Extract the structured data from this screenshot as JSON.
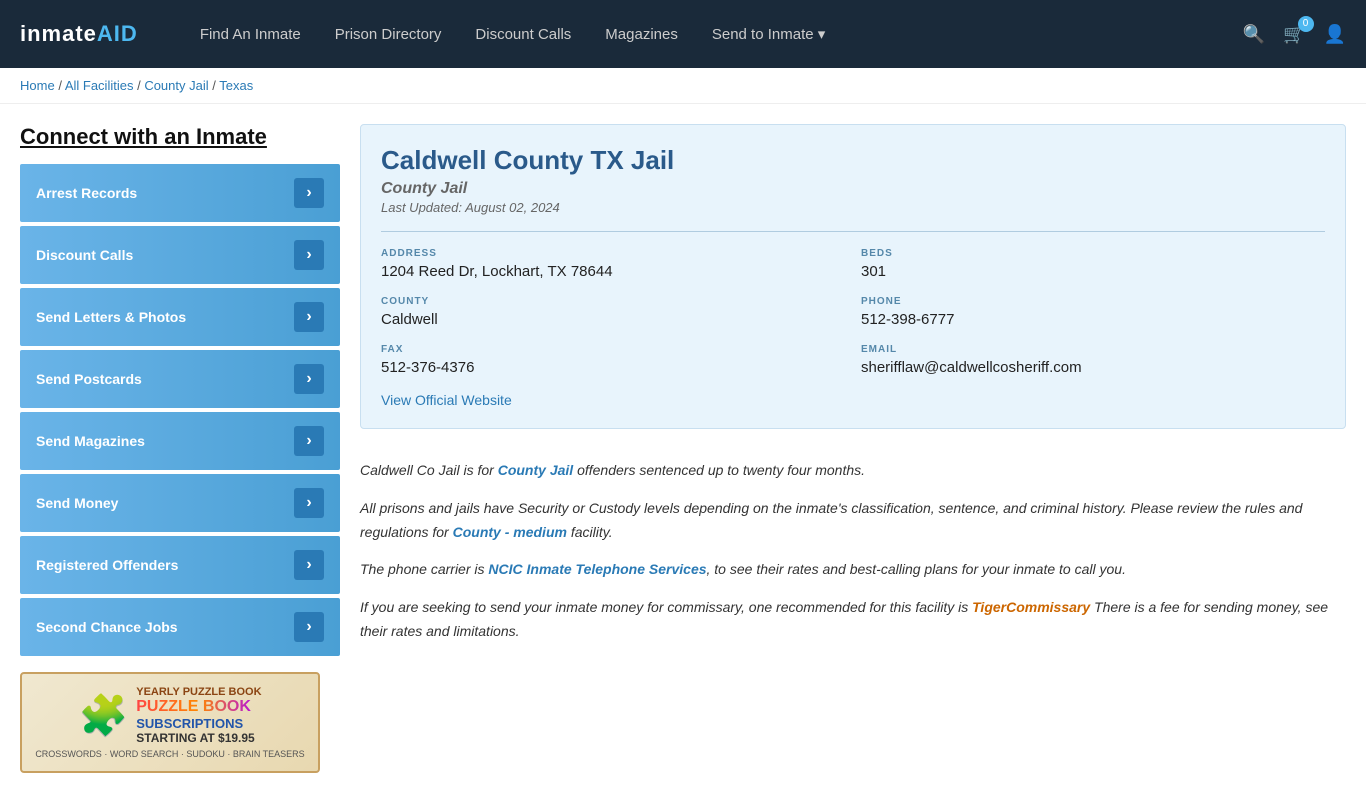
{
  "header": {
    "logo": "inmateAID",
    "logo_highlight": "AID",
    "nav": [
      {
        "label": "Find An Inmate",
        "id": "find-an-inmate"
      },
      {
        "label": "Prison Directory",
        "id": "prison-directory"
      },
      {
        "label": "Discount Calls",
        "id": "discount-calls"
      },
      {
        "label": "Magazines",
        "id": "magazines"
      },
      {
        "label": "Send to Inmate ▾",
        "id": "send-to-inmate"
      }
    ],
    "cart_count": "0",
    "icons": {
      "search": "🔍",
      "cart": "🛒",
      "user": "👤"
    }
  },
  "breadcrumb": {
    "items": [
      "Home",
      "All Facilities",
      "County Jail",
      "Texas"
    ]
  },
  "sidebar": {
    "title": "Connect with an Inmate",
    "menu_items": [
      {
        "label": "Arrest Records",
        "id": "arrest-records"
      },
      {
        "label": "Discount Calls",
        "id": "discount-calls"
      },
      {
        "label": "Send Letters & Photos",
        "id": "send-letters-photos"
      },
      {
        "label": "Send Postcards",
        "id": "send-postcards"
      },
      {
        "label": "Send Magazines",
        "id": "send-magazines"
      },
      {
        "label": "Send Money",
        "id": "send-money"
      },
      {
        "label": "Registered Offenders",
        "id": "registered-offenders"
      },
      {
        "label": "Second Chance Jobs",
        "id": "second-chance-jobs"
      }
    ]
  },
  "ad": {
    "yearly_label": "YEARLY PUZZLE BOOK",
    "title_line1": "PUZZLE BOOK",
    "subscriptions_label": "SUBSCRIPTIONS",
    "price": "STARTING AT $19.95",
    "types": "CROSSWORDS · WORD SEARCH · SUDOKU · BRAIN TEASERS"
  },
  "facility": {
    "name": "Caldwell County TX Jail",
    "type": "County Jail",
    "last_updated": "Last Updated: August 02, 2024",
    "address_label": "ADDRESS",
    "address": "1204 Reed Dr, Lockhart, TX 78644",
    "beds_label": "BEDS",
    "beds": "301",
    "county_label": "COUNTY",
    "county": "Caldwell",
    "phone_label": "PHONE",
    "phone": "512-398-6777",
    "fax_label": "FAX",
    "fax": "512-376-4376",
    "email_label": "EMAIL",
    "email": "sherifflaw@caldwellcosheriff.com",
    "website_link": "View Official Website"
  },
  "description": {
    "para1_prefix": "Caldwell Co Jail is for ",
    "para1_link": "County Jail",
    "para1_suffix": " offenders sentenced up to twenty four months.",
    "para2_prefix": "All prisons and jails have Security or Custody levels depending on the inmate's classification, sentence, and criminal history. Please review the rules and regulations for ",
    "para2_link": "County - medium",
    "para2_suffix": " facility.",
    "para3_prefix": "The phone carrier is ",
    "para3_link": "NCIC Inmate Telephone Services",
    "para3_suffix": ", to see their rates and best-calling plans for your inmate to call you.",
    "para4_prefix": "If you are seeking to send your inmate money for commissary, one recommended for this facility is ",
    "para4_link": "TigerCommissary",
    "para4_suffix": " There is a fee for sending money, see their rates and limitations."
  }
}
